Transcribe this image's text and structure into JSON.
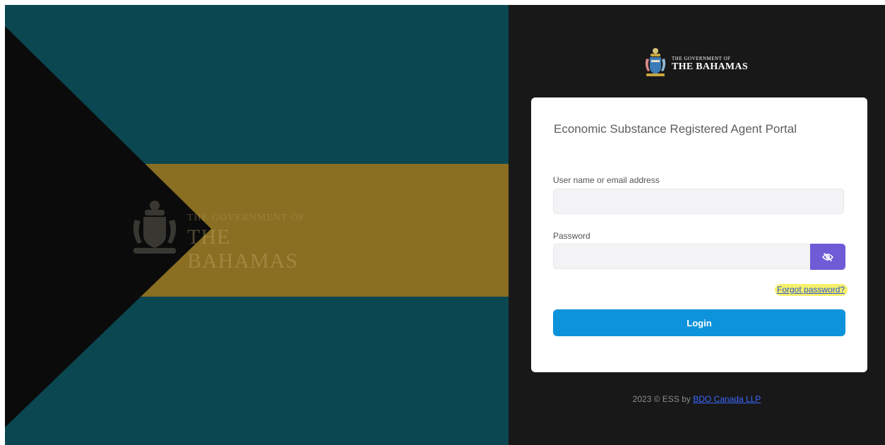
{
  "hero": {
    "watermark_line1": "THE GOVERNMENT OF",
    "watermark_line2": "THE BAHAMAS",
    "colors": {
      "aquamarine": "#0b4751",
      "gold": "#8a6e22",
      "black": "#0b0b0b"
    }
  },
  "logo": {
    "line1": "THE GOVERNMENT OF",
    "line2": "THE BAHAMAS",
    "icon": "coat-of-arms-icon"
  },
  "login_card": {
    "title": "Economic Substance Registered Agent Portal",
    "username_label": "User name or email address",
    "username_value": "",
    "password_label": "Password",
    "password_value": "",
    "toggle_icon": "eye-slash-icon",
    "forgot_password": "Forgot password?",
    "login_button": "Login"
  },
  "footer": {
    "prefix": "2023 © ESS by",
    "company_link": "BDO Canada LLP"
  },
  "colors": {
    "accent_purple": "#6f5bd6",
    "login_blue": "#0d93db",
    "link_blue": "#2a53d3",
    "highlight_yellow": "#f5f06b"
  }
}
